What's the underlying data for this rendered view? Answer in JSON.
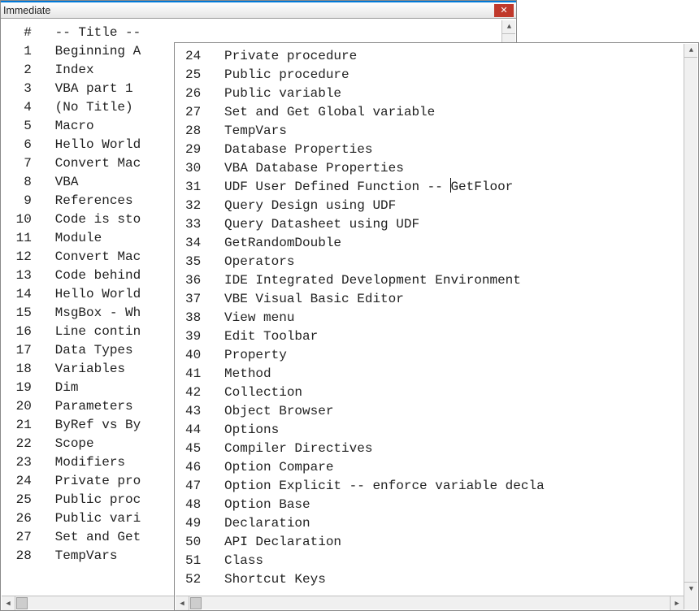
{
  "immediate_window": {
    "title": "Immediate",
    "rows": [
      {
        "num": "#",
        "text": "-- Title --"
      },
      {
        "num": "1",
        "text": "Beginning A"
      },
      {
        "num": "2",
        "text": "Index"
      },
      {
        "num": "3",
        "text": "VBA part 1"
      },
      {
        "num": "4",
        "text": "(No Title)"
      },
      {
        "num": "5",
        "text": "Macro"
      },
      {
        "num": "6",
        "text": "Hello World"
      },
      {
        "num": "7",
        "text": "Convert Mac"
      },
      {
        "num": "8",
        "text": "VBA"
      },
      {
        "num": "9",
        "text": "References"
      },
      {
        "num": "10",
        "text": "Code is sto"
      },
      {
        "num": "11",
        "text": "Module"
      },
      {
        "num": "12",
        "text": "Convert Mac"
      },
      {
        "num": "13",
        "text": "Code behind"
      },
      {
        "num": "14",
        "text": "Hello World"
      },
      {
        "num": "15",
        "text": "MsgBox - Wh"
      },
      {
        "num": "16",
        "text": "Line contin"
      },
      {
        "num": "17",
        "text": "Data Types"
      },
      {
        "num": "18",
        "text": "Variables"
      },
      {
        "num": "19",
        "text": "Dim"
      },
      {
        "num": "20",
        "text": "Parameters"
      },
      {
        "num": "21",
        "text": "ByRef vs By"
      },
      {
        "num": "22",
        "text": "Scope"
      },
      {
        "num": "23",
        "text": "Modifiers"
      },
      {
        "num": "24",
        "text": "Private pro"
      },
      {
        "num": "25",
        "text": "Public proc"
      },
      {
        "num": "26",
        "text": "Public vari"
      },
      {
        "num": "27",
        "text": "Set and Get"
      },
      {
        "num": "28",
        "text": "TempVars"
      }
    ]
  },
  "front_window": {
    "caret_row_index": 7,
    "rows": [
      {
        "num": "24",
        "text": "Private procedure"
      },
      {
        "num": "25",
        "text": "Public procedure"
      },
      {
        "num": "26",
        "text": "Public variable"
      },
      {
        "num": "27",
        "text": "Set and Get Global variable"
      },
      {
        "num": "28",
        "text": "TempVars"
      },
      {
        "num": "29",
        "text": "Database Properties"
      },
      {
        "num": "30",
        "text": "VBA Database Properties"
      },
      {
        "num": "31",
        "pre": "UDF User Defined Function -- ",
        "post": "GetFloor"
      },
      {
        "num": "32",
        "text": "Query Design using UDF"
      },
      {
        "num": "33",
        "text": "Query Datasheet using UDF"
      },
      {
        "num": "34",
        "text": "GetRandomDouble"
      },
      {
        "num": "35",
        "text": "Operators"
      },
      {
        "num": "36",
        "text": "IDE Integrated Development Environment"
      },
      {
        "num": "37",
        "text": "VBE Visual Basic Editor"
      },
      {
        "num": "38",
        "text": "View menu"
      },
      {
        "num": "39",
        "text": "Edit Toolbar"
      },
      {
        "num": "40",
        "text": "Property"
      },
      {
        "num": "41",
        "text": "Method"
      },
      {
        "num": "42",
        "text": "Collection"
      },
      {
        "num": "43",
        "text": "Object Browser"
      },
      {
        "num": "44",
        "text": "Options"
      },
      {
        "num": "45",
        "text": "Compiler Directives"
      },
      {
        "num": "46",
        "text": "Option Compare"
      },
      {
        "num": "47",
        "text": "Option Explicit -- enforce variable decla"
      },
      {
        "num": "48",
        "text": "Option Base"
      },
      {
        "num": "49",
        "text": "Declaration"
      },
      {
        "num": "50",
        "text": "API Declaration"
      },
      {
        "num": "51",
        "text": "Class"
      },
      {
        "num": "52",
        "text": "Shortcut Keys"
      }
    ]
  },
  "glyphs": {
    "up": "▲",
    "down": "▼",
    "left": "◀",
    "right": "▶",
    "close": "✕"
  }
}
